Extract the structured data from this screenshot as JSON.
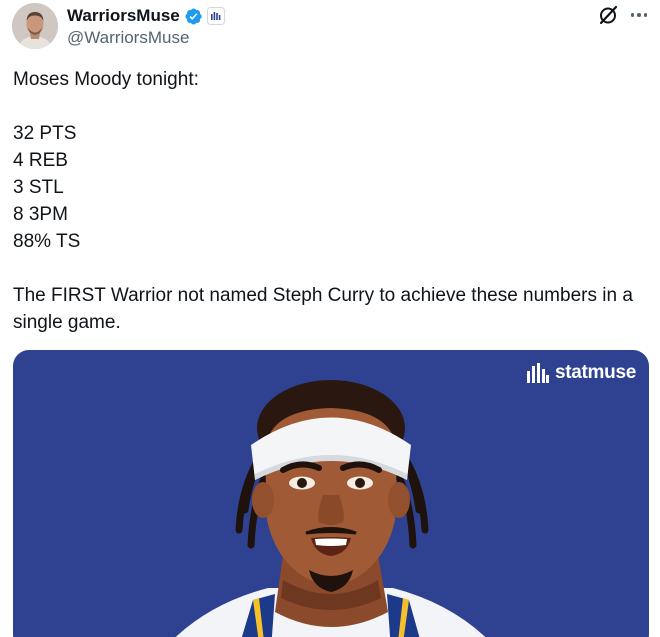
{
  "user": {
    "display_name": "WarriorsMuse",
    "handle": "@WarriorsMuse",
    "verified": true,
    "avatar_icon": "person-avatar-icon"
  },
  "header_actions": {
    "grok_icon": "grok-slash-circle-icon",
    "more_icon": "more-dots-icon"
  },
  "tweet": {
    "lines": [
      "Moses Moody tonight:",
      "",
      "32 PTS",
      "4 REB",
      "3 STL",
      "8 3PM",
      "88% TS",
      "",
      "The FIRST Warrior not named Steph Curry to achieve these numbers in a single game."
    ]
  },
  "media": {
    "brand": "statmuse",
    "background_color": "#2e4291",
    "image_subject": "player-illustration"
  },
  "colors": {
    "verified_blue": "#1d9bf0",
    "text_primary": "#0f1419",
    "text_secondary": "#536471"
  }
}
